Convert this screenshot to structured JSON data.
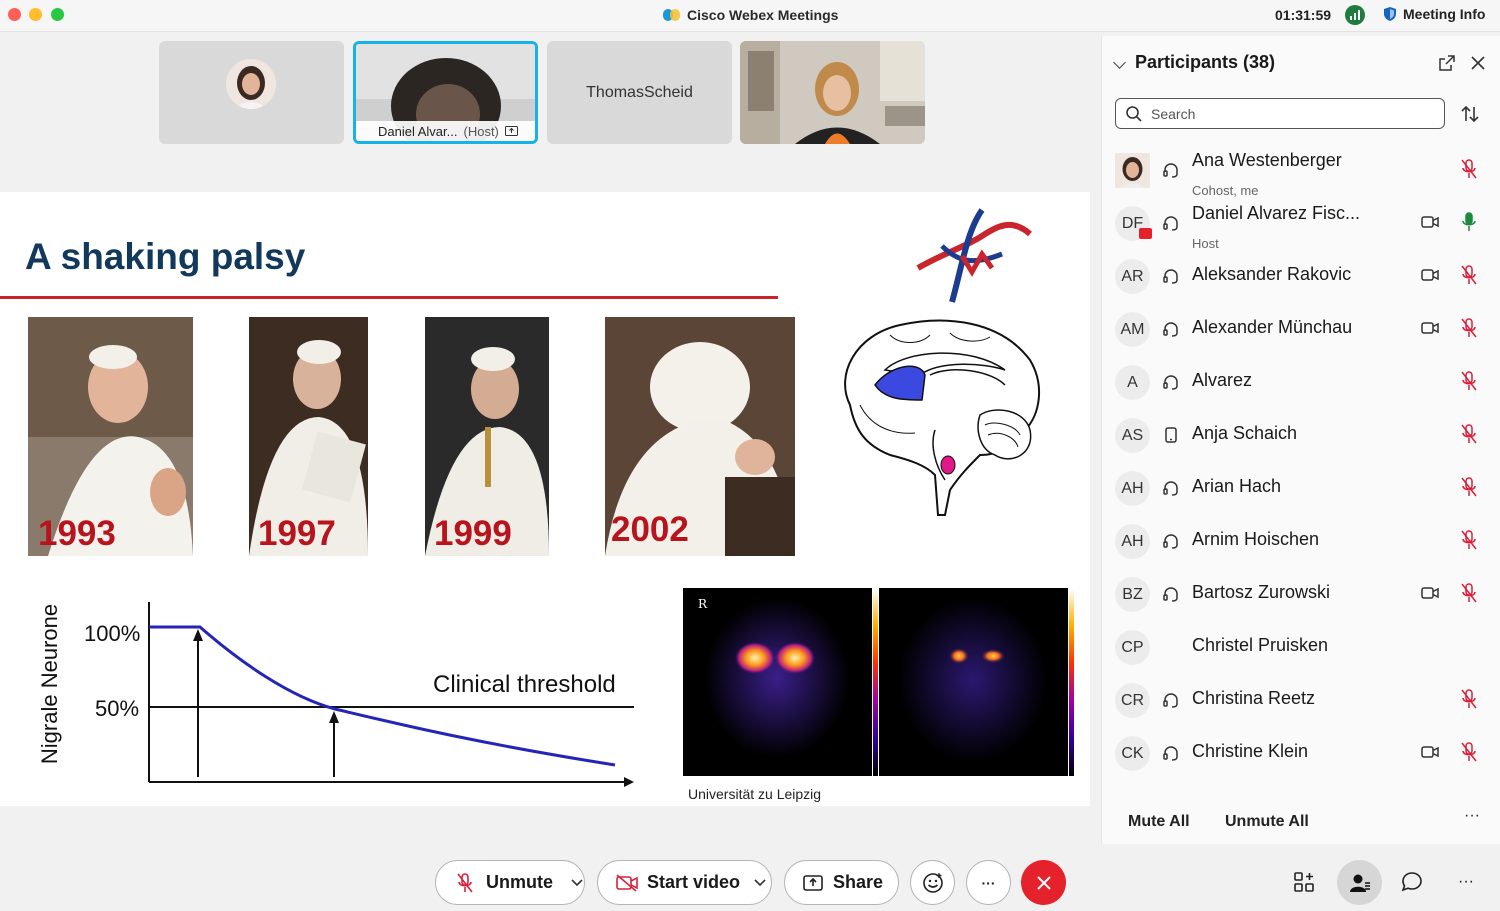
{
  "window": {
    "app_title": "Cisco Webex Meetings",
    "clock": "01:31:59",
    "meeting_info_label": "Meeting Info"
  },
  "video_strip": {
    "tiles": [
      {
        "name": "",
        "type": "avatar"
      },
      {
        "name": "Daniel Alvar...",
        "host_label": "(Host)",
        "type": "video",
        "active": true
      },
      {
        "name": "ThomasScheid",
        "type": "name-only"
      },
      {
        "name": "",
        "type": "video"
      }
    ]
  },
  "slide": {
    "title": "A shaking palsy",
    "years": [
      "1993",
      "1997",
      "1999",
      "2002"
    ],
    "chart": {
      "ylabel": "Nigrale Neurone",
      "tick_100": "100%",
      "tick_50": "50%",
      "threshold_label": "Clinical threshold"
    },
    "scan_marker": "R",
    "caption": "Universität zu Leipzig"
  },
  "participants_panel": {
    "title": "Participants (38)",
    "search_placeholder": "Search",
    "participants": [
      {
        "initials": "",
        "name": "Ana Westenberger",
        "role": "Cohost, me",
        "audio": "headset",
        "camera": false,
        "mic": "muted",
        "photo": true
      },
      {
        "initials": "DF",
        "name": "Daniel Alvarez Fisc...",
        "role": "Host",
        "audio": "headset",
        "camera": true,
        "mic": "unmuted",
        "sharing": true
      },
      {
        "initials": "AR",
        "name": "Aleksander Rakovic",
        "role": "",
        "audio": "headset",
        "camera": true,
        "mic": "muted"
      },
      {
        "initials": "AM",
        "name": "Alexander Münchau",
        "role": "",
        "audio": "headset",
        "camera": true,
        "mic": "muted"
      },
      {
        "initials": "A",
        "name": "Alvarez",
        "role": "",
        "audio": "headset",
        "camera": false,
        "mic": "muted"
      },
      {
        "initials": "AS",
        "name": "Anja Schaich",
        "role": "",
        "audio": "phone",
        "camera": false,
        "mic": "muted"
      },
      {
        "initials": "AH",
        "name": "Arian Hach",
        "role": "",
        "audio": "headset",
        "camera": false,
        "mic": "muted"
      },
      {
        "initials": "AH",
        "name": "Arnim Hoischen",
        "role": "",
        "audio": "headset",
        "camera": false,
        "mic": "muted"
      },
      {
        "initials": "BZ",
        "name": "Bartosz Zurowski",
        "role": "",
        "audio": "headset",
        "camera": true,
        "mic": "muted"
      },
      {
        "initials": "CP",
        "name": "Christel Pruisken",
        "role": "",
        "audio": "none",
        "camera": false,
        "mic": "none"
      },
      {
        "initials": "CR",
        "name": "Christina Reetz",
        "role": "",
        "audio": "headset",
        "camera": false,
        "mic": "muted"
      },
      {
        "initials": "CK",
        "name": "Christine Klein",
        "role": "",
        "audio": "headset",
        "camera": true,
        "mic": "muted"
      }
    ],
    "mute_all": "Mute All",
    "unmute_all": "Unmute All",
    "more": "···"
  },
  "toolbar": {
    "unmute_label": "Unmute",
    "start_video_label": "Start video",
    "share_label": "Share",
    "more_label": "···",
    "more_right": "···"
  },
  "colors": {
    "accent_blue": "#18b3e6",
    "end_red": "#e5212b",
    "muted_red": "#d9203a",
    "unmuted_green": "#1e8a3e",
    "slide_title": "#12395c",
    "slide_red": "#b7141d"
  }
}
